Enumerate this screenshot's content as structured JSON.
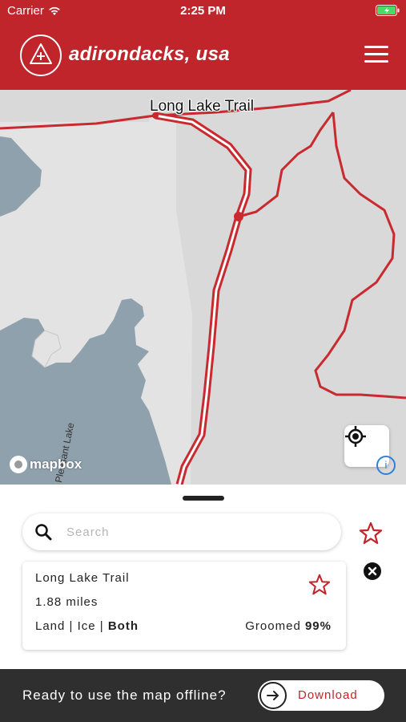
{
  "status": {
    "carrier": "Carrier",
    "time": "2:25 PM"
  },
  "header": {
    "brand": "adirondacks, usa",
    "accent_color": "#c0252b"
  },
  "map": {
    "trail_label": "Long Lake Trail",
    "lake_label": "Pleasant Lake",
    "attribution": "mapbox",
    "info_label": "i"
  },
  "search": {
    "placeholder": "Search",
    "value": ""
  },
  "trail_card": {
    "name": "Long Lake Trail",
    "distance": "1.88 miles",
    "type_prefix": "Land | Ice | ",
    "type_selected": "Both",
    "groomed_label": "Groomed ",
    "groomed_value": "99%"
  },
  "offline": {
    "prompt": "Ready to use the map offline?",
    "button_label": "Download"
  },
  "icons": {
    "logo": "triangle-compass-icon",
    "menu": "hamburger-menu-icon",
    "locate": "crosshair-locate-icon",
    "search": "search-icon",
    "favorite": "star-outline-icon",
    "close": "close-circle-icon",
    "download": "arrow-right-icon"
  }
}
